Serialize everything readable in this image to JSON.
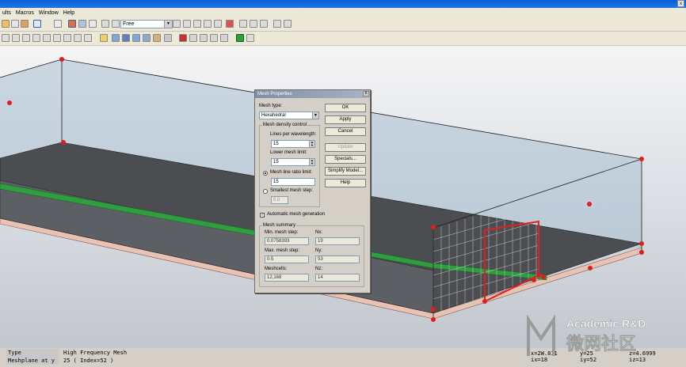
{
  "menu": [
    "ults",
    "Macros",
    "Window",
    "Help"
  ],
  "window_controls": {
    "close": "x"
  },
  "toolbar": {
    "mode_select": "Free"
  },
  "dialog": {
    "title": "Mesh Properties",
    "close": "x",
    "mesh_type_label": "Mesh type:",
    "mesh_type_value": "Hexahedral",
    "density_group": "Mesh density control",
    "lines_per_wavelength_label": "Lines per wavelength:",
    "lines_per_wavelength_value": "15",
    "lower_mesh_limit_label": "Lower mesh limit:",
    "lower_mesh_limit_value": "15",
    "ratio_limit_label": "Mesh line ratio limit:",
    "ratio_limit_value": "15",
    "smallest_step_label": "Smallest mesh step:",
    "smallest_step_value": "0.0",
    "auto_mesh_label": "Automatic mesh generation",
    "summary_group": "Mesh summary",
    "min_step_label": "Min. mesh step:",
    "min_step_value": "0.0758393",
    "nx_label": "Nx:",
    "nx_value": "19",
    "max_step_label": "Max. mesh step:",
    "max_step_value": "0.5",
    "ny_label": "Ny:",
    "ny_value": "53",
    "meshcells_label": "Meshcells:",
    "meshcells_value": "12,168",
    "nz_label": "Nz:",
    "nz_value": "14",
    "buttons": {
      "ok": "OK",
      "apply": "Apply",
      "cancel": "Cancel",
      "update": "Update",
      "specials": "Specials...",
      "simplify": "Simplify Model...",
      "help": "Help"
    }
  },
  "info": {
    "rows": [
      {
        "key": "Type",
        "value": "High Frequency Mesh"
      },
      {
        "key": "Meshplane at y",
        "value": "25 ( Index=52 )"
      }
    ]
  },
  "coords": {
    "x": "x=2W.811",
    "y": "y=25",
    "z": "z=4.6999",
    "ix": "ix=18",
    "iy": "iy=52",
    "iz": "iz=13"
  },
  "watermark": {
    "line1": "Academic R&D",
    "line2": "微网社区"
  }
}
